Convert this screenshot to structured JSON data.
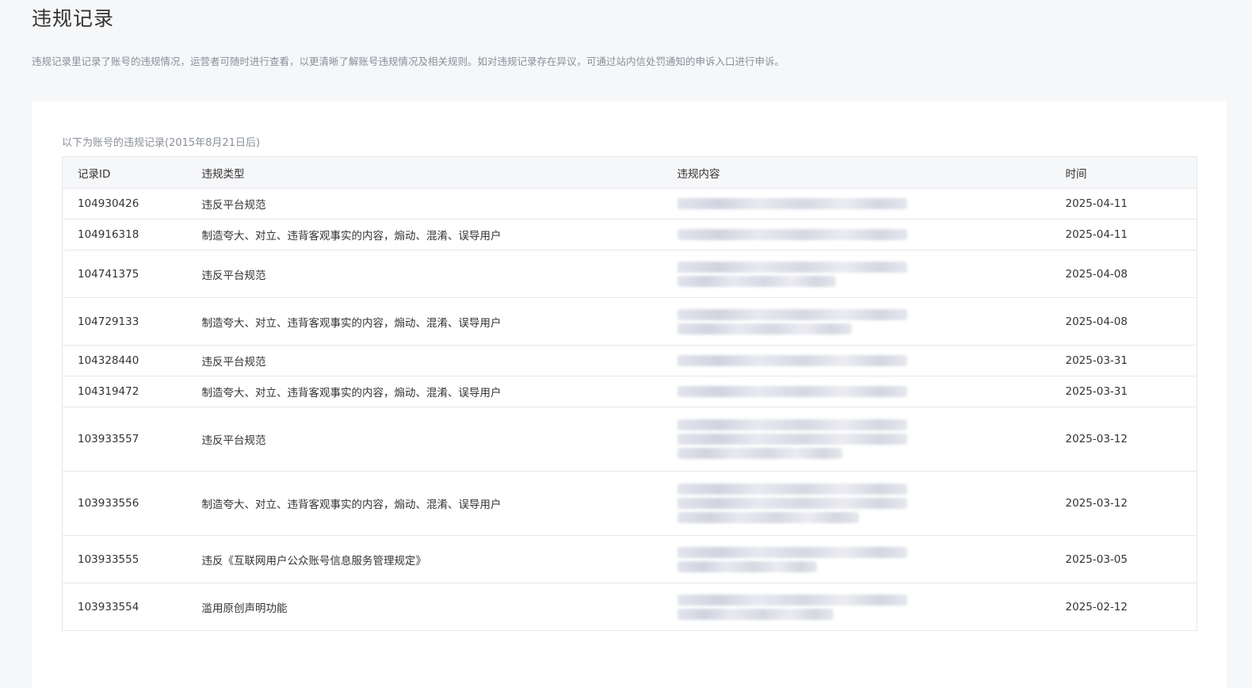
{
  "page": {
    "title": "违规记录",
    "description": "违规记录里记录了账号的违规情况，运营者可随时进行查看，以更清晰了解账号违规情况及相关规则。如对违规记录存在异议，可通过站内信处罚通知的申诉入口进行申诉。"
  },
  "table": {
    "caption": "以下为账号的违规记录(2015年8月21日后)",
    "headers": {
      "id": "记录ID",
      "type": "违规类型",
      "content": "违规内容",
      "time": "时间"
    },
    "rows": [
      {
        "id": "104930426",
        "type": "违反平台规范",
        "time": "2025-04-11",
        "lines": 1
      },
      {
        "id": "104916318",
        "type": "制造夸大、对立、违背客观事实的内容，煽动、混淆、误导用户",
        "time": "2025-04-11",
        "lines": 1
      },
      {
        "id": "104741375",
        "type": "违反平台规范",
        "time": "2025-04-08",
        "lines": 2
      },
      {
        "id": "104729133",
        "type": "制造夸大、对立、违背客观事实的内容，煽动、混淆、误导用户",
        "time": "2025-04-08",
        "lines": 2
      },
      {
        "id": "104328440",
        "type": "违反平台规范",
        "time": "2025-03-31",
        "lines": 1
      },
      {
        "id": "104319472",
        "type": "制造夸大、对立、违背客观事实的内容，煽动、混淆、误导用户",
        "time": "2025-03-31",
        "lines": 1
      },
      {
        "id": "103933557",
        "type": "违反平台规范",
        "time": "2025-03-12",
        "lines": 3
      },
      {
        "id": "103933556",
        "type": "制造夸大、对立、违背客观事实的内容，煽动、混淆、误导用户",
        "time": "2025-03-12",
        "lines": 3
      },
      {
        "id": "103933555",
        "type": "违反《互联网用户公众账号信息服务管理规定》",
        "time": "2025-03-05",
        "lines": 2
      },
      {
        "id": "103933554",
        "type": "滥用原创声明功能",
        "time": "2025-02-12",
        "lines": 2
      }
    ]
  }
}
